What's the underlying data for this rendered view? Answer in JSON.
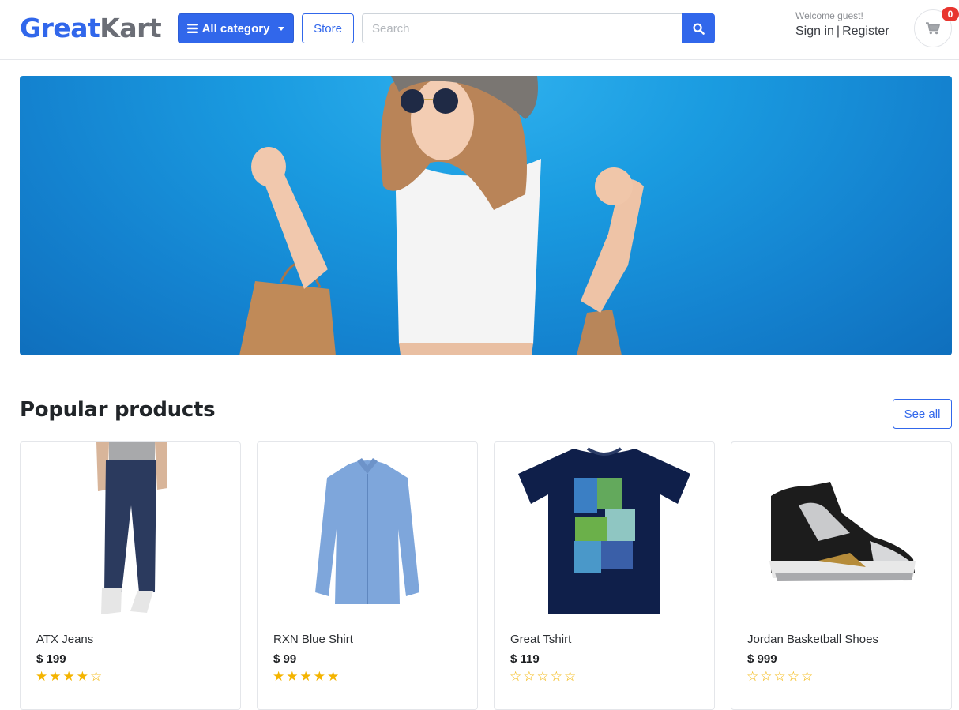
{
  "brand": {
    "name_part1": "Great",
    "name_part2": "Kart"
  },
  "nav": {
    "category_label": "All category",
    "store_label": "Store"
  },
  "search": {
    "placeholder": "Search",
    "value": ""
  },
  "account": {
    "welcome": "Welcome guest!",
    "sign_in": "Sign in",
    "separator": "|",
    "register": "Register"
  },
  "cart": {
    "count": "0"
  },
  "section": {
    "title": "Popular products",
    "see_all_label": "See all"
  },
  "products": [
    {
      "name": "ATX Jeans",
      "price": "$ 199",
      "rating": 4,
      "image_icon": "jeans-image"
    },
    {
      "name": "RXN Blue Shirt",
      "price": "$ 99",
      "rating": 5,
      "image_icon": "blue-shirt-image"
    },
    {
      "name": "Great Tshirt",
      "price": "$ 119",
      "rating": 0,
      "image_icon": "graphic-tshirt-image"
    },
    {
      "name": "Jordan Basketball Shoes",
      "price": "$ 999",
      "rating": 0,
      "image_icon": "basketball-shoe-image"
    }
  ],
  "colors": {
    "primary": "#3167eb",
    "logo_secondary": "#6b6e76",
    "badge": "#e8352f",
    "star": "#f4b400",
    "hero_bg": "#1a9be0"
  },
  "icons": {
    "category": "bars-icon",
    "search": "search-icon",
    "cart": "shopping-cart-icon"
  }
}
